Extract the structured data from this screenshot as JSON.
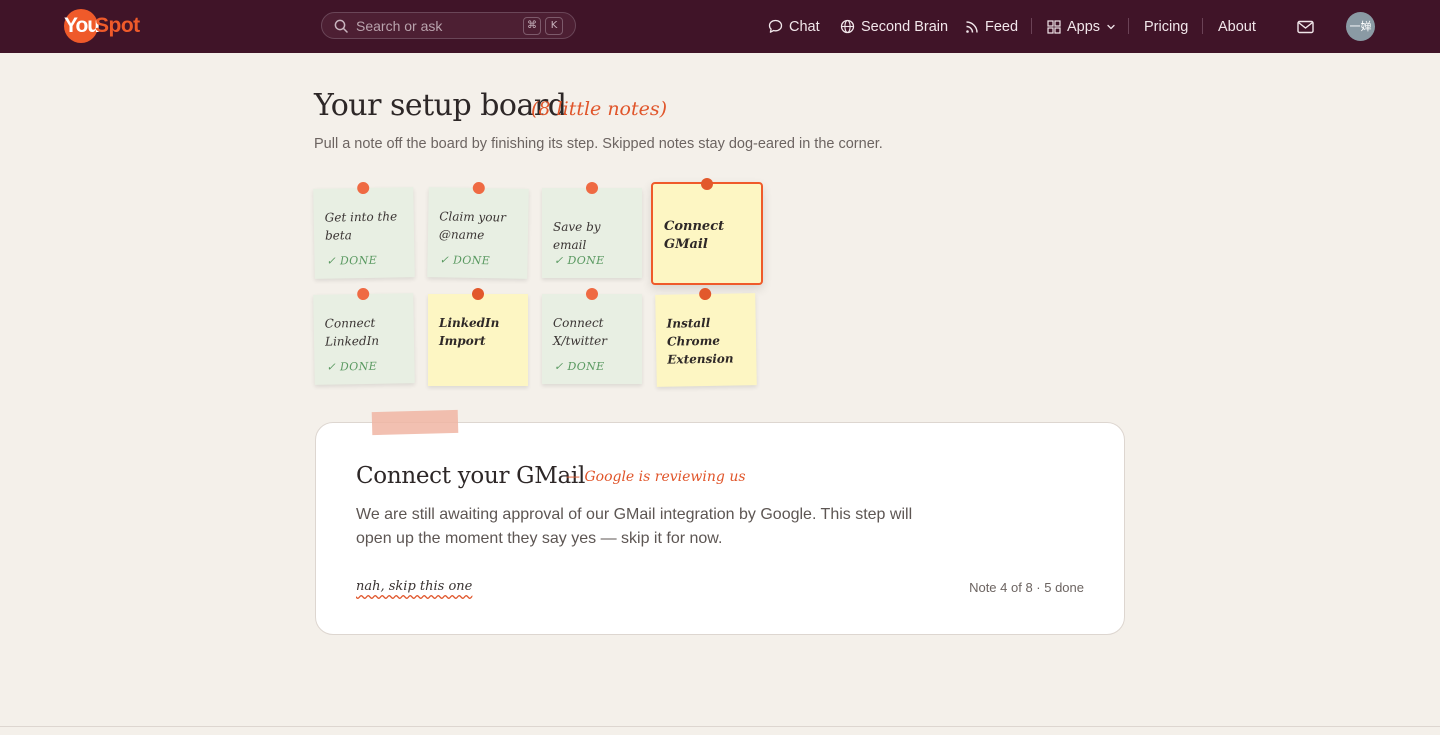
{
  "brand": {
    "logo_badge": "You",
    "logo_rest": "Spot",
    "color": "#ef5a2a"
  },
  "search": {
    "placeholder": "Search or ask",
    "shortcut_mod": "⌘",
    "shortcut_key": "K"
  },
  "nav": {
    "chat": "Chat",
    "second_brain": "Second Brain",
    "feed": "Feed",
    "apps": "Apps",
    "pricing": "Pricing",
    "about": "About"
  },
  "user": {
    "avatar_text": "一婵"
  },
  "page": {
    "title": "Your setup board",
    "title_aside": "(8 little notes)",
    "subtitle": "Pull a note off the board by finishing its step. Skipped notes stay dog-eared in the corner."
  },
  "notes": [
    {
      "label": "Get into the beta",
      "status": "✓ DONE",
      "state": "done"
    },
    {
      "label": "Claim your @name",
      "status": "✓ DONE",
      "state": "done"
    },
    {
      "label": "Save by email",
      "status": "✓ DONE",
      "state": "done"
    },
    {
      "label": "Connect GMail",
      "status": "",
      "state": "active"
    },
    {
      "label": "Connect LinkedIn",
      "status": "✓ DONE",
      "state": "done"
    },
    {
      "label": "LinkedIn Import",
      "status": "",
      "state": "todo"
    },
    {
      "label": "Connect X/twitter",
      "status": "✓ DONE",
      "state": "done"
    },
    {
      "label": "Install Chrome Extension",
      "status": "",
      "state": "todo"
    }
  ],
  "detail": {
    "title": "Connect your GMail",
    "aside": "— Google is reviewing us",
    "body": "We are still awaiting approval of our GMail integration by Google. This step will open up the moment they say yes — skip it for now.",
    "skip_label": "nah, skip this one",
    "progress": "Note 4 of 8 · 5 done"
  },
  "colors": {
    "topbar": "#401428",
    "accent": "#ef5a2a",
    "done_note": "#e8efe3",
    "todo_note": "#fdf6c3",
    "done_text": "#5b9a62"
  }
}
